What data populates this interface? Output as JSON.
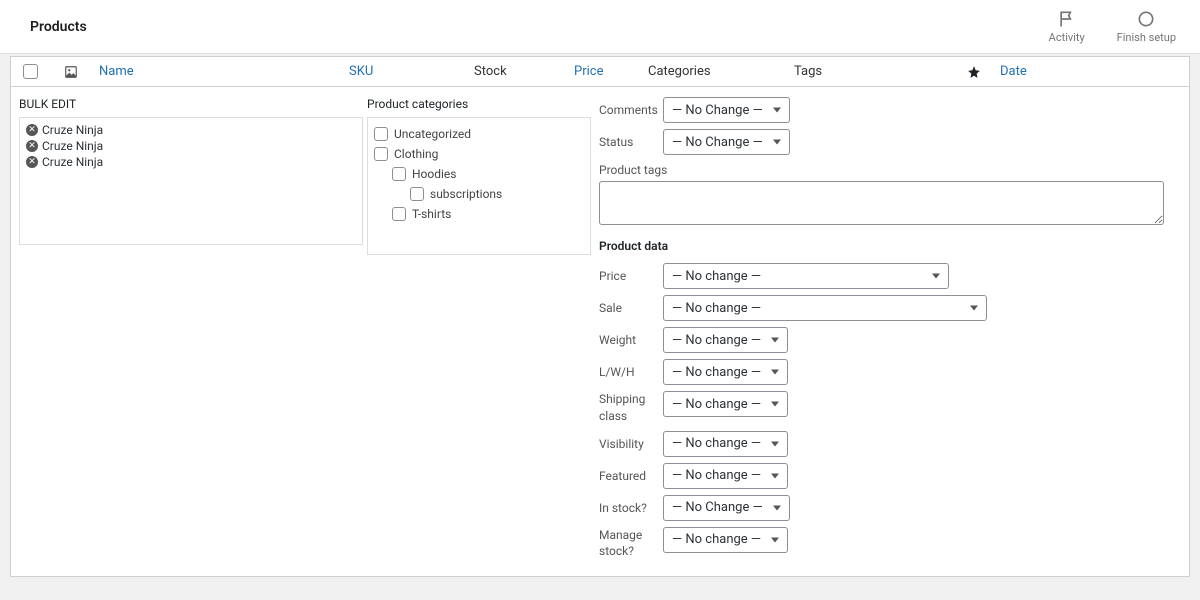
{
  "header": {
    "title": "Products",
    "activity_label": "Activity",
    "finish_label": "Finish setup"
  },
  "columns": {
    "name": "Name",
    "sku": "SKU",
    "stock": "Stock",
    "price": "Price",
    "categories": "Categories",
    "tags": "Tags",
    "date": "Date"
  },
  "bulk": {
    "title": "BULK EDIT",
    "titles": [
      "Cruze Ninja",
      "Cruze Ninja",
      "Cruze Ninja"
    ],
    "cat_title": "Product categories",
    "categories": [
      {
        "label": "Uncategorized",
        "indent": 0
      },
      {
        "label": "Clothing",
        "indent": 0
      },
      {
        "label": "Hoodies",
        "indent": 1
      },
      {
        "label": "subscriptions",
        "indent": 2
      },
      {
        "label": "T-shirts",
        "indent": 1
      }
    ]
  },
  "fields": {
    "comments": {
      "label": "Comments",
      "value": "— No Change —"
    },
    "status": {
      "label": "Status",
      "value": "— No Change —"
    },
    "tags_label": "Product tags",
    "pdata_title": "Product data",
    "price": {
      "label": "Price",
      "value": "— No change —"
    },
    "sale": {
      "label": "Sale",
      "value": "— No change —"
    },
    "weight": {
      "label": "Weight",
      "value": "— No change —"
    },
    "lwh": {
      "label": "L/W/H",
      "value": "— No change —"
    },
    "shipping": {
      "label": "Shipping class",
      "value": "— No change —"
    },
    "visibility": {
      "label": "Visibility",
      "value": "— No change —"
    },
    "featured": {
      "label": "Featured",
      "value": "— No change —"
    },
    "instock": {
      "label": "In stock?",
      "value": "— No Change —"
    },
    "manage": {
      "label": "Manage stock?",
      "value": "— No change —"
    }
  }
}
